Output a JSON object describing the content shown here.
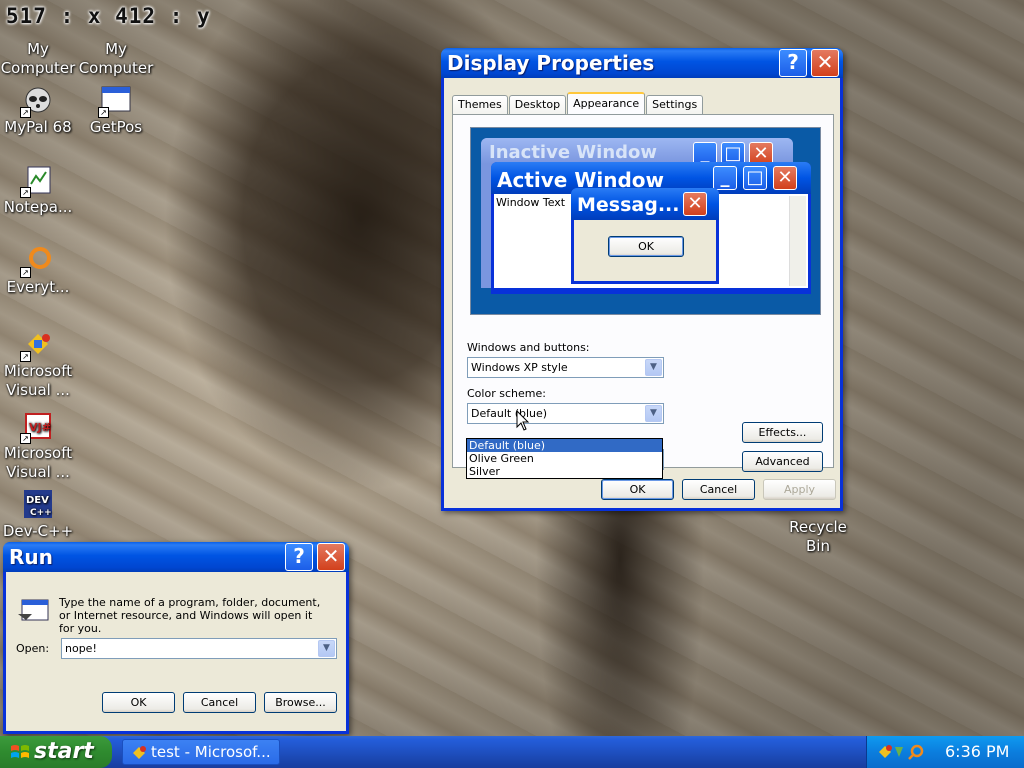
{
  "coordinate_readout": "517 : x 412 : y",
  "desktop_icons": [
    {
      "label": "My Computer"
    },
    {
      "label": "My Computer"
    },
    {
      "label": "MyPal 68"
    },
    {
      "label": "GetPos"
    },
    {
      "label": "Notepa..."
    },
    {
      "label": "Everyt..."
    },
    {
      "label": "Microsoft Visual ..."
    },
    {
      "label": "Microsoft Visual ..."
    },
    {
      "label": "Dev-C++"
    },
    {
      "label": "Recycle Bin"
    }
  ],
  "display_properties": {
    "title": "Display Properties",
    "help_button": "?",
    "close_button": "✕",
    "tabs": [
      "Themes",
      "Desktop",
      "Appearance",
      "Settings"
    ],
    "active_tab": "Appearance",
    "preview": {
      "inactive_title": "Inactive Window",
      "active_title": "Active Window",
      "window_text": "Window Text",
      "message_title": "Messag...",
      "message_ok": "OK"
    },
    "windows_buttons_label": "Windows and buttons:",
    "windows_buttons_value": "Windows XP style",
    "color_scheme_label": "Color scheme:",
    "color_scheme_value": "Default (blue)",
    "color_scheme_options": [
      "Default (blue)",
      "Olive Green",
      "Silver"
    ],
    "color_scheme_highlighted": "Default (blue)",
    "effects_button": "Effects...",
    "advanced_button": "Advanced",
    "ok_button": "OK",
    "cancel_button": "Cancel",
    "apply_button": "Apply"
  },
  "run_dialog": {
    "title": "Run",
    "help_button": "?",
    "close_button": "✕",
    "description": "Type the name of a program, folder, document, or Internet resource, and Windows will open it for you.",
    "open_label": "Open:",
    "open_value": "nope!",
    "ok_button": "OK",
    "cancel_button": "Cancel",
    "browse_button": "Browse..."
  },
  "taskbar": {
    "start_label": "start",
    "task_item": "test - Microsof...",
    "clock": "6:36 PM"
  },
  "colors": {
    "xp_blue": "#0054e3",
    "start_green": "#2f8b2f",
    "dialog_bg": "#ece9d8",
    "selection": "#316ac5"
  }
}
